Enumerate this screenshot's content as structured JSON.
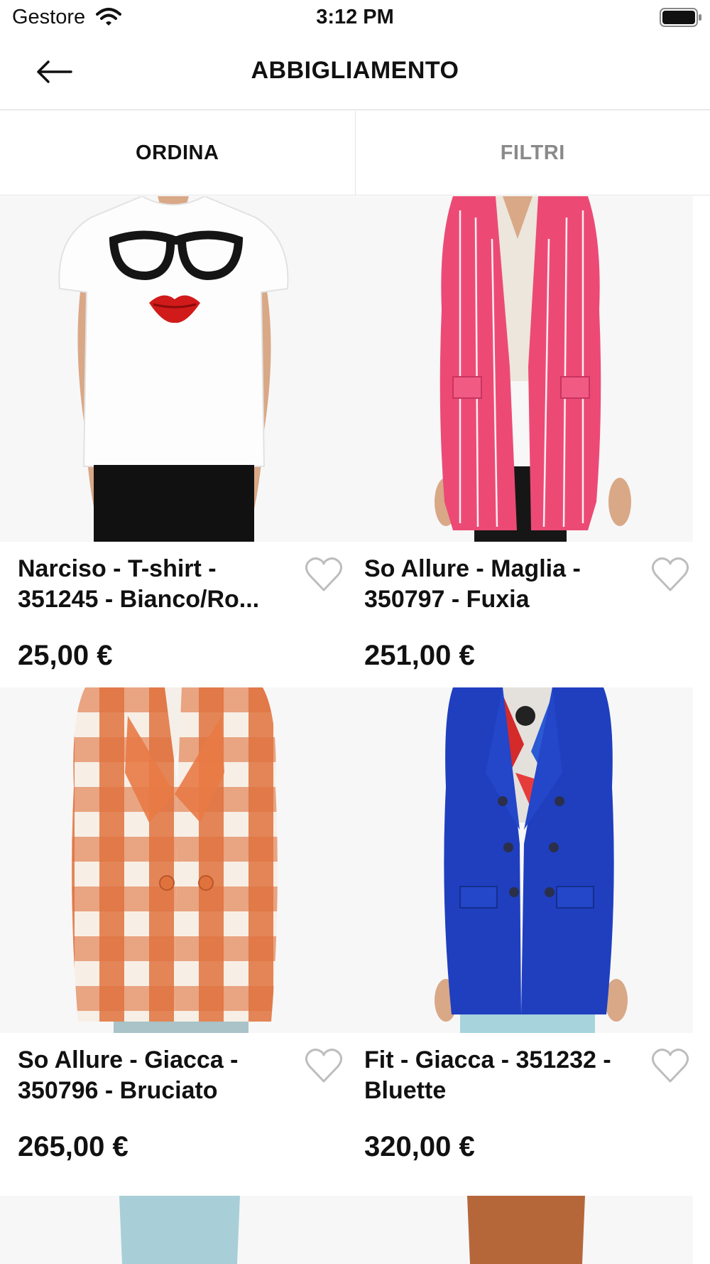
{
  "status_bar": {
    "carrier": "Gestore",
    "time": "3:12 PM",
    "icons": [
      "wifi-icon",
      "battery-icon"
    ]
  },
  "nav": {
    "title": "ABBIGLIAMENTO",
    "back_icon": "arrow-left-icon"
  },
  "toolbar": {
    "sort_label": "ORDINA",
    "filter_label": "FILTRI"
  },
  "products": [
    {
      "name": "Narciso - T-shirt - 351245 - Bianco/Ro...",
      "price": "25,00 €",
      "favorite_icon": "heart-outline-icon"
    },
    {
      "name": "So Allure - Maglia - 350797 - Fuxia",
      "price": "251,00 €",
      "favorite_icon": "heart-outline-icon"
    },
    {
      "name": "So Allure - Giacca - 350796 - Bruciato",
      "price": "265,00 €",
      "favorite_icon": "heart-outline-icon"
    },
    {
      "name": "Fit - Giacca - 351232 - Bluette",
      "price": "320,00 €",
      "favorite_icon": "heart-outline-icon"
    }
  ],
  "colors": {
    "text": "#111111",
    "inactive_tab": "#8a8a8a",
    "divider": "#e4e4e4",
    "image_bg": "#f6f6f6"
  }
}
